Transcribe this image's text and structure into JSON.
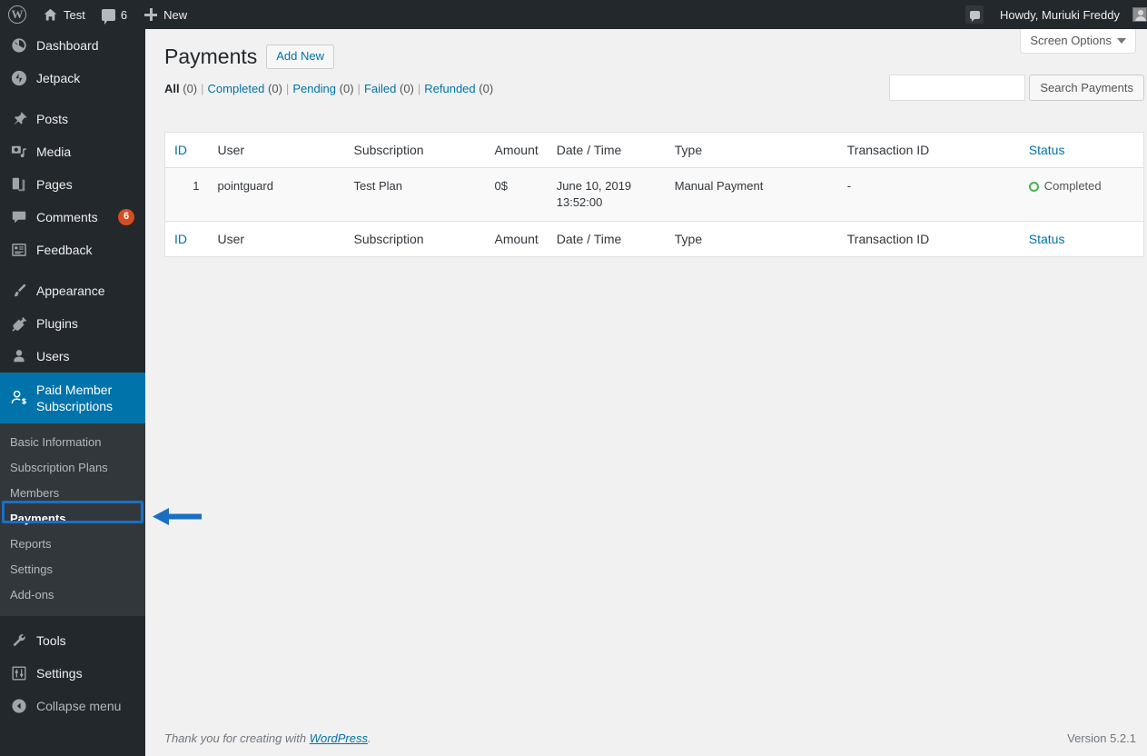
{
  "adminbar": {
    "wp_logo": "wordpress-logo-icon",
    "site_name": "Test",
    "comments_count": "6",
    "new_label": "New",
    "howdy": "Howdy, Muriuki Freddy"
  },
  "sidebar": {
    "items": [
      {
        "label": "Dashboard",
        "icon": "dashboard-icon"
      },
      {
        "label": "Jetpack",
        "icon": "jetpack-icon"
      },
      {
        "label": "Posts",
        "icon": "pin-icon"
      },
      {
        "label": "Media",
        "icon": "media-icon"
      },
      {
        "label": "Pages",
        "icon": "pages-icon"
      },
      {
        "label": "Comments",
        "icon": "comment-icon",
        "badge": "6"
      },
      {
        "label": "Feedback",
        "icon": "feedback-icon"
      },
      {
        "label": "Appearance",
        "icon": "brush-icon"
      },
      {
        "label": "Plugins",
        "icon": "plugin-icon"
      },
      {
        "label": "Users",
        "icon": "user-icon"
      },
      {
        "label": "Paid Member Subscriptions",
        "icon": "member-dollar-icon",
        "active": true
      },
      {
        "label": "Tools",
        "icon": "wrench-icon"
      },
      {
        "label": "Settings",
        "icon": "sliders-icon"
      },
      {
        "label": "Collapse menu",
        "icon": "collapse-icon"
      }
    ],
    "submenu": [
      {
        "label": "Basic Information"
      },
      {
        "label": "Subscription Plans"
      },
      {
        "label": "Members"
      },
      {
        "label": "Payments",
        "current": true
      },
      {
        "label": "Reports"
      },
      {
        "label": "Settings"
      },
      {
        "label": "Add-ons"
      }
    ]
  },
  "screen_options": {
    "label": "Screen Options"
  },
  "header": {
    "title": "Payments",
    "add_new": "Add New"
  },
  "filters": [
    {
      "label": "All",
      "count": "(0)",
      "current": true
    },
    {
      "label": "Completed",
      "count": "(0)"
    },
    {
      "label": "Pending",
      "count": "(0)"
    },
    {
      "label": "Failed",
      "count": "(0)"
    },
    {
      "label": "Refunded",
      "count": "(0)"
    }
  ],
  "search": {
    "value": "",
    "placeholder": "",
    "button": "Search Payments"
  },
  "table": {
    "columns": {
      "id": "ID",
      "user": "User",
      "subscription": "Subscription",
      "amount": "Amount",
      "datetime": "Date / Time",
      "type": "Type",
      "transaction": "Transaction ID",
      "status": "Status"
    },
    "rows": [
      {
        "id": "1",
        "user": "pointguard",
        "subscription": "Test Plan",
        "amount": "0$",
        "date": "June 10, 2019",
        "time": "13:52:00",
        "type": "Manual Payment",
        "transaction": "-",
        "status": "Completed"
      }
    ]
  },
  "footer": {
    "thanks_prefix": "Thank you for creating with ",
    "thanks_link": "WordPress",
    "thanks_suffix": ".",
    "version": "Version 5.2.1"
  },
  "colors": {
    "admin_dark": "#23282d",
    "submenu_dark": "#32373c",
    "accent_blue": "#0073aa",
    "link_blue": "#0073aa",
    "highlight_blue": "#1a6fc4",
    "badge_orange": "#d54e21",
    "status_green": "#46b450",
    "page_bg": "#f1f1f1"
  }
}
